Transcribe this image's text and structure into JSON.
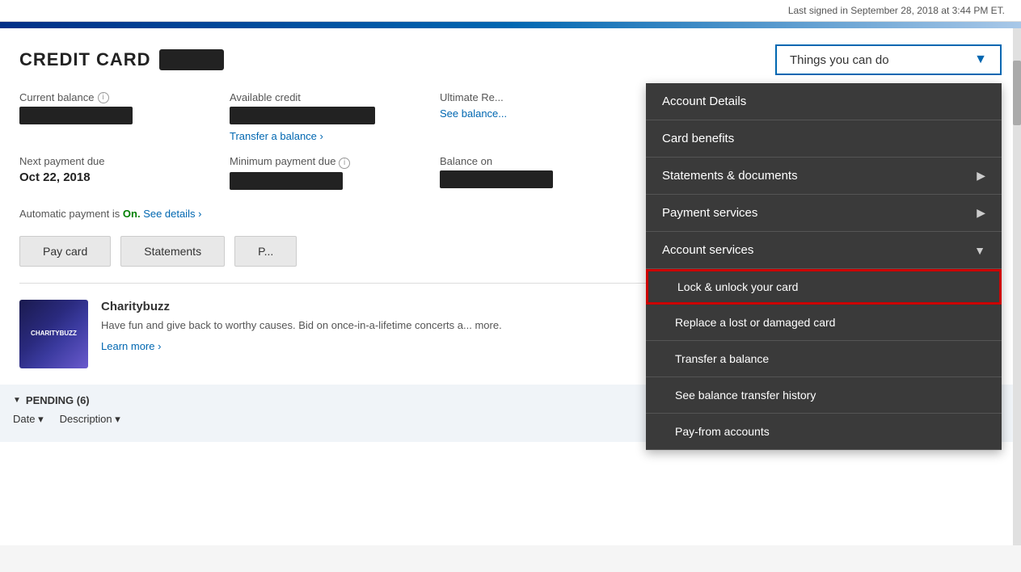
{
  "topbar": {
    "last_signed": "Last signed in September 28, 2018 at 3:44 PM ET."
  },
  "card": {
    "title": "CREDIT CARD",
    "masked_number": "████"
  },
  "dropdown": {
    "label": "Things you can do",
    "arrow": "▼"
  },
  "balances": {
    "current_balance_label": "Current balance",
    "available_credit_label": "Available credit",
    "ultimate_rewards_label": "Ultimate Re...",
    "see_balance_link": "See balance...",
    "transfer_link": "Transfer a balance ›"
  },
  "payment": {
    "next_due_label": "Next payment due",
    "next_due_value": "Oct 22, 2018",
    "minimum_due_label": "Minimum payment due",
    "balance_on_label": "Balance on",
    "auto_payment_prefix": "Automatic payment is ",
    "auto_payment_status": "On.",
    "auto_payment_suffix": " See details ›"
  },
  "buttons": {
    "pay_card": "Pay card",
    "statements": "Statements",
    "third_btn": "P..."
  },
  "charity": {
    "name": "Charitybuzz",
    "description": "Have fun and give back to worthy causes. Bid on once-in-a-lifetime concerts a... more.",
    "learn_more": "Learn more ›",
    "img_text": "CHARITYBUZZ"
  },
  "pending": {
    "title": "PENDING (6)",
    "triangle": "▼"
  },
  "table": {
    "date_col": "Date ▾",
    "desc_col": "Description ▾"
  },
  "menu": {
    "items": [
      {
        "id": "account-details",
        "label": "Account Details",
        "has_arrow": false,
        "sub": false,
        "highlighted": false
      },
      {
        "id": "card-benefits",
        "label": "Card benefits",
        "has_arrow": false,
        "sub": false,
        "highlighted": false
      },
      {
        "id": "statements-docs",
        "label": "Statements & documents",
        "has_arrow": true,
        "sub": false,
        "highlighted": false
      },
      {
        "id": "payment-services",
        "label": "Payment services",
        "has_arrow": true,
        "sub": false,
        "highlighted": false
      },
      {
        "id": "account-services",
        "label": "Account services",
        "has_arrow": true,
        "sub": false,
        "highlighted": false
      },
      {
        "id": "lock-unlock",
        "label": "Lock & unlock your card",
        "has_arrow": false,
        "sub": true,
        "highlighted": true
      },
      {
        "id": "replace-card",
        "label": "Replace a lost or damaged card",
        "has_arrow": false,
        "sub": true,
        "highlighted": false
      },
      {
        "id": "transfer-balance",
        "label": "Transfer a balance",
        "has_arrow": false,
        "sub": true,
        "highlighted": false
      },
      {
        "id": "balance-history",
        "label": "See balance transfer history",
        "has_arrow": false,
        "sub": true,
        "highlighted": false
      },
      {
        "id": "pay-from",
        "label": "Pay-from accounts",
        "has_arrow": false,
        "sub": true,
        "highlighted": false
      }
    ]
  }
}
